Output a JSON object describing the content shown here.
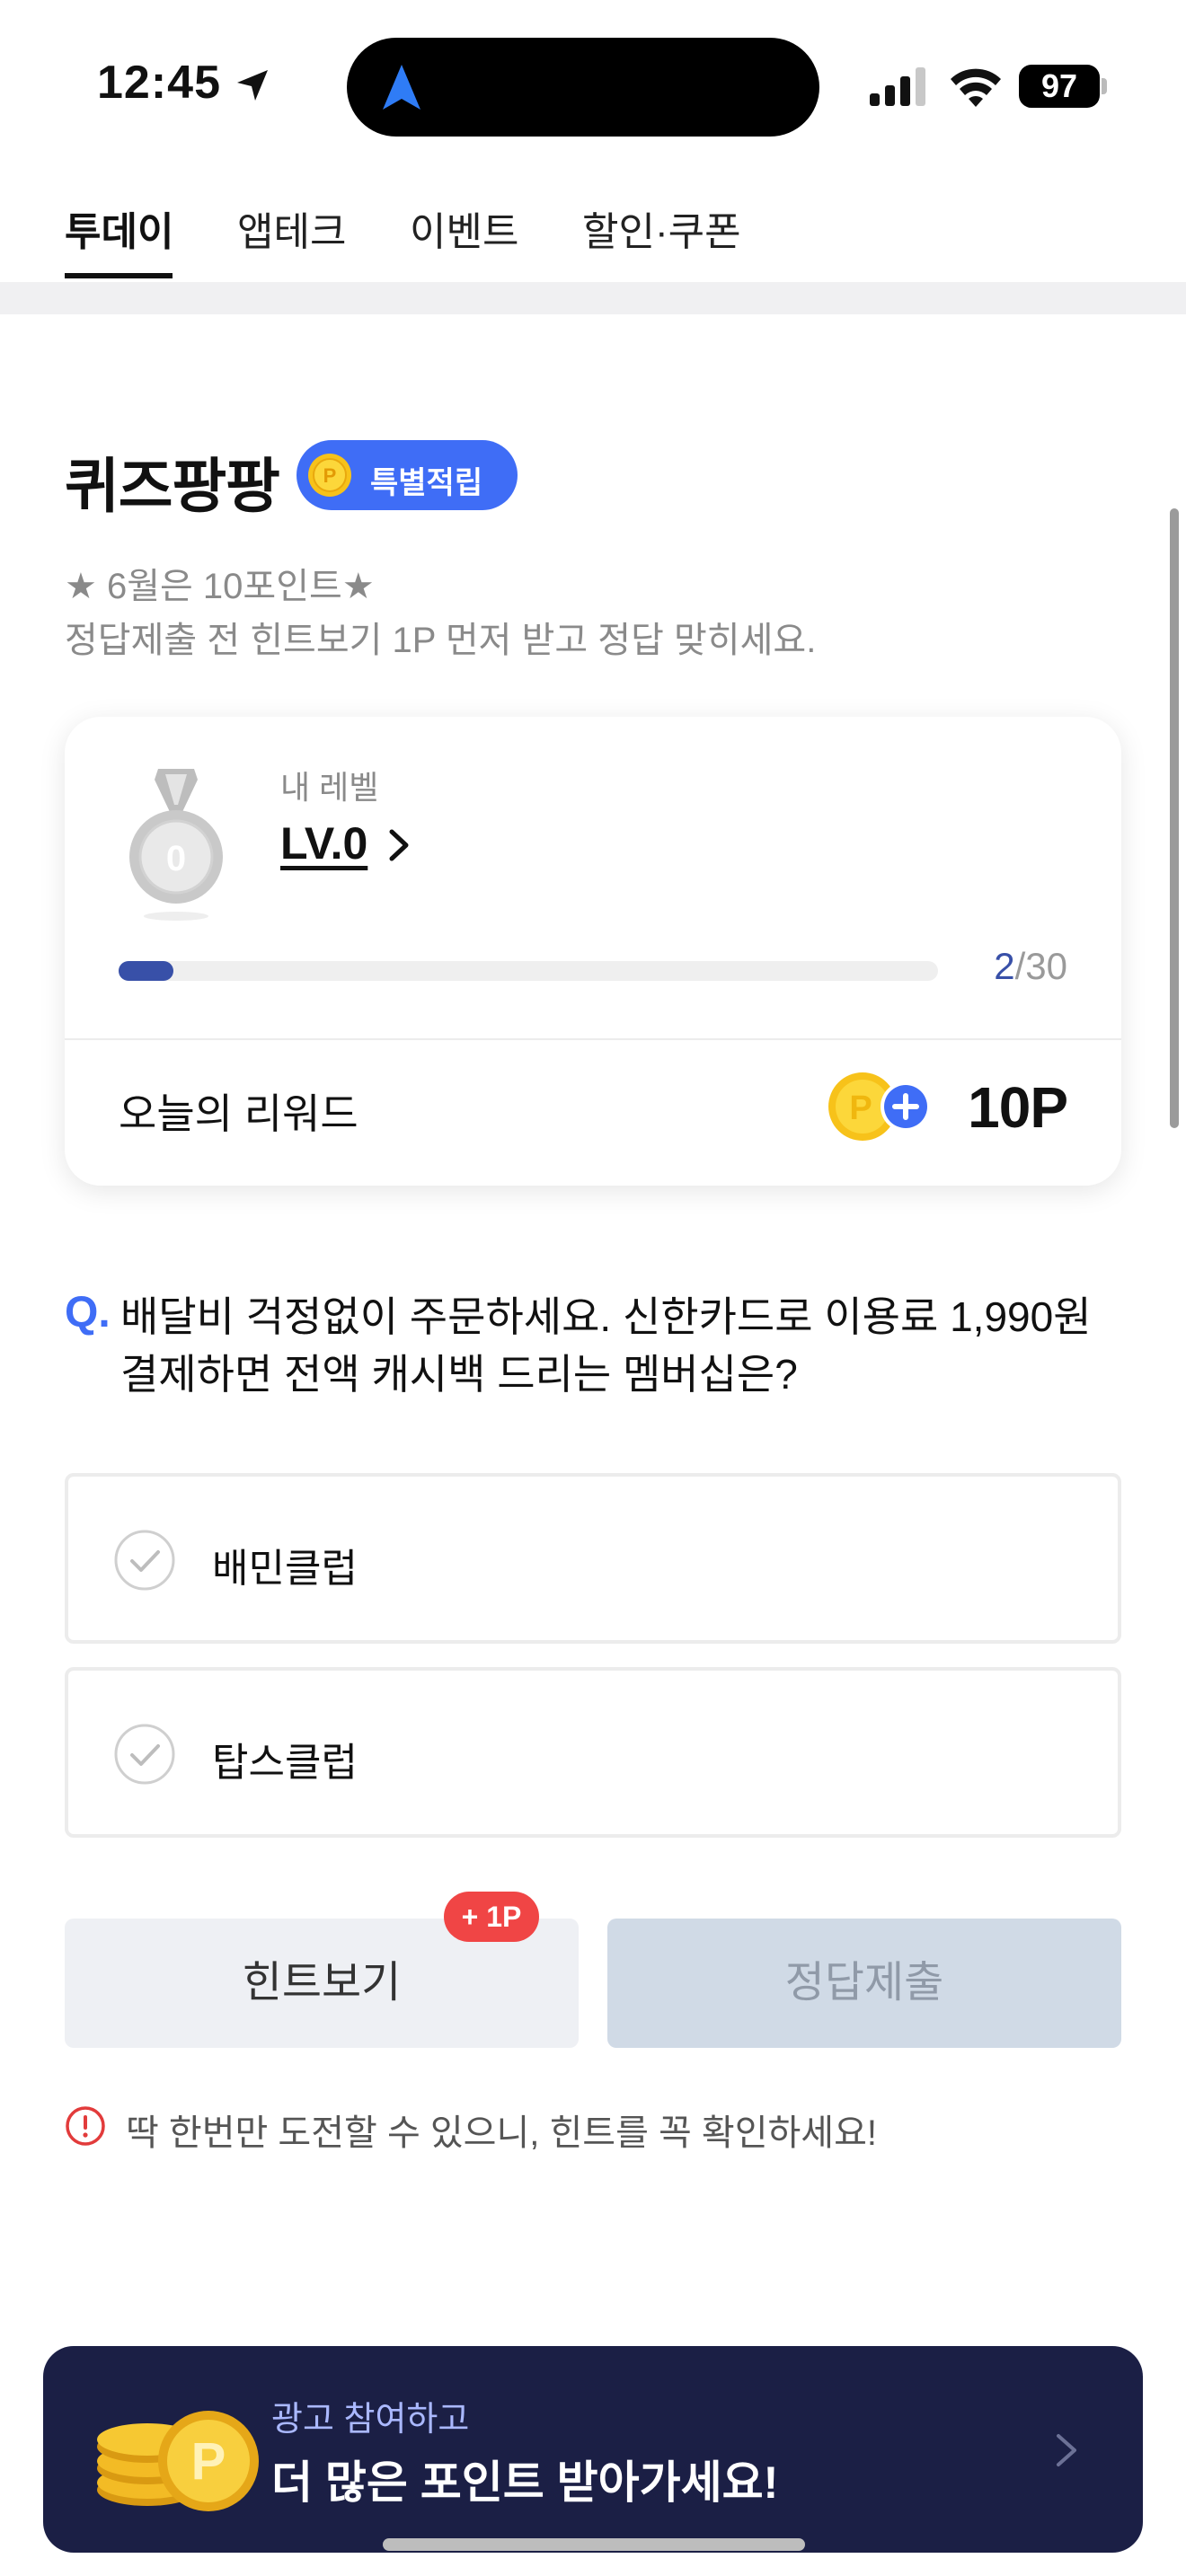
{
  "status_bar": {
    "time": "12:45",
    "battery": "97"
  },
  "tabs": [
    {
      "label": "투데이"
    },
    {
      "label": "앱테크"
    },
    {
      "label": "이벤트"
    },
    {
      "label": "할인·쿠폰"
    }
  ],
  "quiz": {
    "title": "퀴즈팡팡",
    "badge": "특별적립",
    "notice_line1": "★ 6월은 10포인트★",
    "notice_line2": "정답제출 전 힌트보기 1P 먼저 받고 정답 맞히세요."
  },
  "level_card": {
    "label": "내 레벨",
    "level": "LV.0",
    "medal_number": "0",
    "progress_current": "2",
    "progress_total": "/30",
    "progress_fraction": 0.0667,
    "reward_label": "오늘의 리워드",
    "reward_value": "10P"
  },
  "question": {
    "mark": "Q.",
    "text": "배달비 걱정없이 주문하세요. 신한카드로 이용료 1,990원 결제하면 전액 캐시백 드리는 멤버십은?",
    "options": [
      {
        "label": "배민클럽"
      },
      {
        "label": "탑스클럽"
      }
    ]
  },
  "actions": {
    "hint_label": "힌트보기",
    "hint_badge": "+ 1P",
    "submit_label": "정답제출"
  },
  "warning": "딱 한번만 도전할 수 있으니, 힌트를 꼭 확인하세요!",
  "ad": {
    "small_text": "광고 참여하고",
    "big_text": "더 많은 포인트 받아가세요!"
  },
  "colors": {
    "accent": "#3f6df6",
    "progress": "#3850a8",
    "ad_background": "#1b1f45",
    "hint_badge": "#f04545"
  }
}
